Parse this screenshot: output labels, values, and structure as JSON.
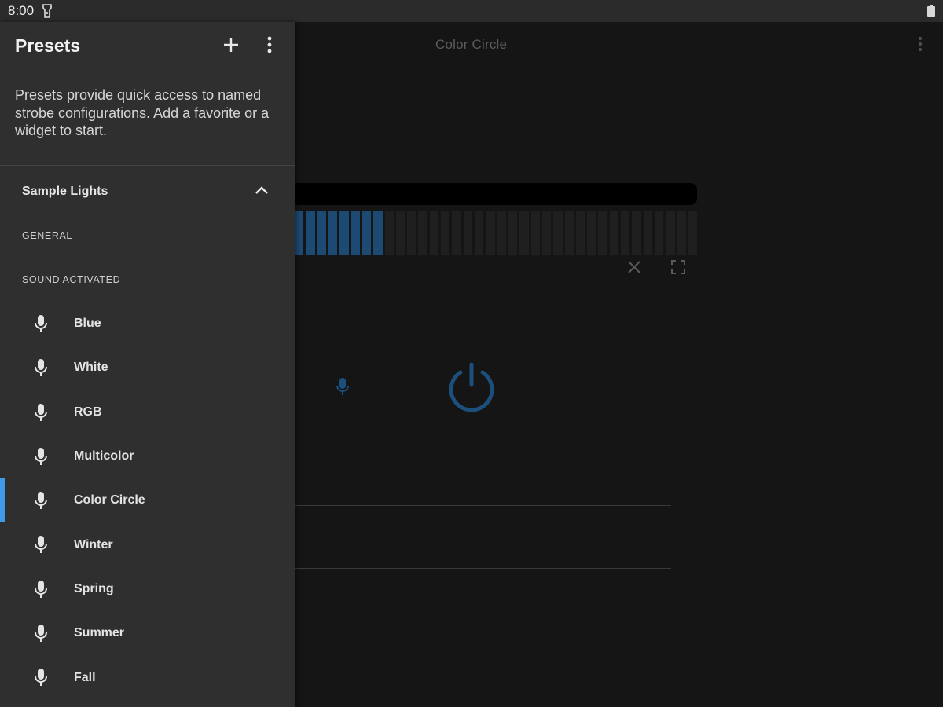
{
  "status_bar": {
    "time": "8:00"
  },
  "main": {
    "title": "Color Circle",
    "meter": {
      "segments": 36,
      "active": 8
    }
  },
  "drawer": {
    "title": "Presets",
    "description": "Presets provide quick access to named strobe configurations. Add a favorite or a widget to start.",
    "group": {
      "label": "Sample Lights",
      "expanded": true
    },
    "sections": {
      "general": "GENERAL",
      "sound_activated": "SOUND ACTIVATED"
    },
    "presets": [
      {
        "label": "Blue",
        "selected": false
      },
      {
        "label": "White",
        "selected": false
      },
      {
        "label": "RGB",
        "selected": false
      },
      {
        "label": "Multicolor",
        "selected": false
      },
      {
        "label": "Color Circle",
        "selected": true
      },
      {
        "label": "Winter",
        "selected": false
      },
      {
        "label": "Spring",
        "selected": false
      },
      {
        "label": "Summer",
        "selected": false
      },
      {
        "label": "Fall",
        "selected": false
      }
    ]
  },
  "colors": {
    "accent": "#3f9be8",
    "meter_on": "#1c4a73",
    "power": "#1d4f7c"
  },
  "icons": {
    "status_flash": "flashlight-icon",
    "status_battery": "battery-icon",
    "add": "plus-icon",
    "overflow": "more-vert-icon",
    "chevron": "chevron-up-icon",
    "preset": "mic-icon",
    "close": "close-icon",
    "fullscreen": "fullscreen-icon",
    "power": "power-icon"
  }
}
